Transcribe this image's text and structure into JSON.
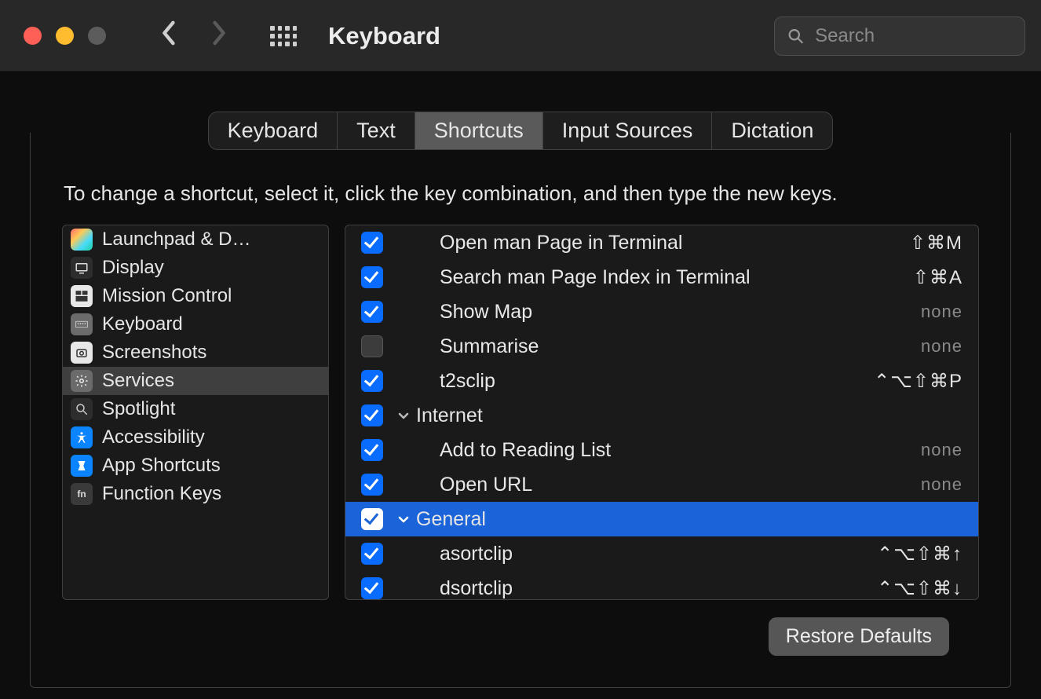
{
  "window": {
    "title": "Keyboard",
    "search_placeholder": "Search"
  },
  "tabs": [
    "Keyboard",
    "Text",
    "Shortcuts",
    "Input Sources",
    "Dictation"
  ],
  "active_tab_index": 2,
  "instruction": "To change a shortcut, select it, click the key combination, and then type the new keys.",
  "sidebar": {
    "selected_index": 5,
    "items": [
      {
        "label": "Launchpad & D…",
        "icon": "launchpad"
      },
      {
        "label": "Display",
        "icon": "display"
      },
      {
        "label": "Mission Control",
        "icon": "mission"
      },
      {
        "label": "Keyboard",
        "icon": "keyboard"
      },
      {
        "label": "Screenshots",
        "icon": "screenshots"
      },
      {
        "label": "Services",
        "icon": "services"
      },
      {
        "label": "Spotlight",
        "icon": "spotlight"
      },
      {
        "label": "Accessibility",
        "icon": "accessibility"
      },
      {
        "label": "App Shortcuts",
        "icon": "app"
      },
      {
        "label": "Function Keys",
        "icon": "fn"
      }
    ]
  },
  "detail": {
    "rows": [
      {
        "type": "item",
        "checked": true,
        "label": "Open man Page in Terminal",
        "shortcut": "⇧⌘M"
      },
      {
        "type": "item",
        "checked": true,
        "label": "Search man Page Index in Terminal",
        "shortcut": "⇧⌘A"
      },
      {
        "type": "item",
        "checked": true,
        "label": "Show Map",
        "shortcut": "none"
      },
      {
        "type": "item",
        "checked": false,
        "label": "Summarise",
        "shortcut": "none"
      },
      {
        "type": "item",
        "checked": true,
        "label": "t2sclip",
        "shortcut": "⌃⌥⇧⌘P"
      },
      {
        "type": "group",
        "checked": true,
        "label": "Internet",
        "expanded": true
      },
      {
        "type": "item",
        "checked": true,
        "label": "Add to Reading List",
        "shortcut": "none"
      },
      {
        "type": "item",
        "checked": true,
        "label": "Open URL",
        "shortcut": "none"
      },
      {
        "type": "group",
        "checked": true,
        "label": "General",
        "expanded": true,
        "selected": true
      },
      {
        "type": "item",
        "checked": true,
        "label": "asortclip",
        "shortcut": "⌃⌥⇧⌘↑"
      },
      {
        "type": "item",
        "checked": true,
        "label": "dsortclip",
        "shortcut": "⌃⌥⇧⌘↓"
      }
    ]
  },
  "footer": {
    "restore_label": "Restore Defaults"
  }
}
